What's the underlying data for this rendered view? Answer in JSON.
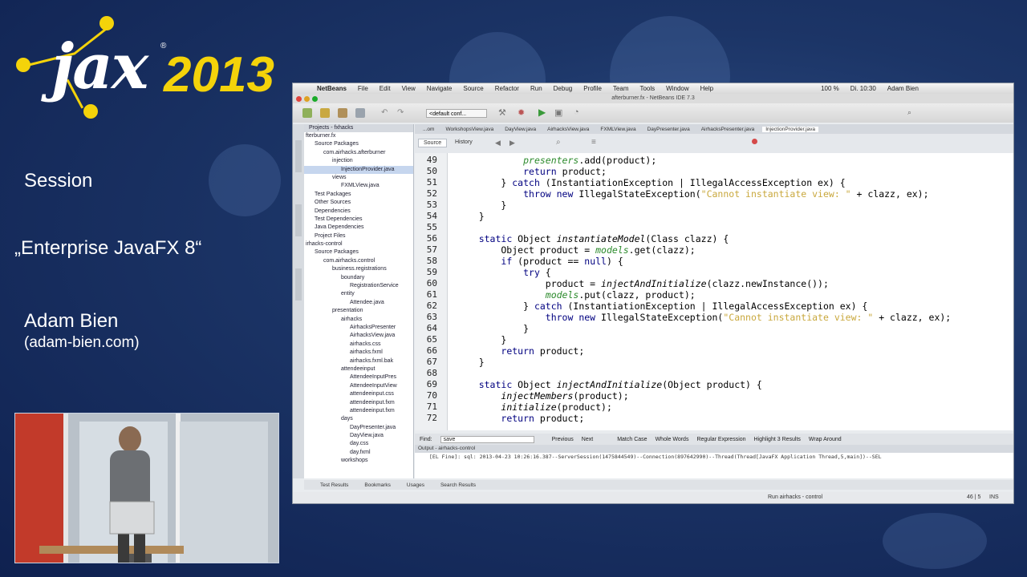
{
  "logo": {
    "word": "jax",
    "year": "2013",
    "reg": "®"
  },
  "sidebar": {
    "label_session": "Session",
    "talk_title": "„Enterprise JavaFX 8“",
    "speaker_name": "Adam Bien",
    "speaker_site": "(adam-bien.com)"
  },
  "ide": {
    "menu": [
      "NetBeans",
      "File",
      "Edit",
      "View",
      "Navigate",
      "Source",
      "Refactor",
      "Run",
      "Debug",
      "Profile",
      "Team",
      "Tools",
      "Window",
      "Help"
    ],
    "clock": "Di. 10:30",
    "battery": "100 %",
    "user": "Adam Bien",
    "window_title": "afterburner.fx - NetBeans IDE 7.3",
    "config_select": "<default conf...",
    "projects_tab": "Projects - fxhacks",
    "tree": [
      "fterburner.fx",
      "Source Packages",
      "com.airhacks.afterburner",
      "injection",
      "InjectionProvider.java",
      "views",
      "FXMLView.java",
      "Test Packages",
      "Other Sources",
      "Dependencies",
      "Test Dependencies",
      "Java Dependencies",
      "Project Files",
      "irhacks-control",
      "Source Packages",
      "com.airhacks.control",
      "business.registrations",
      "boundary",
      "RegistrationService",
      "entity",
      "Attendee.java",
      "presentation",
      "airhacks",
      "AirhacksPresenter",
      "AirhacksView.java",
      "airhacks.css",
      "airhacks.fxml",
      "airhacks.fxml.bak",
      "attendeeinput",
      "AttendeeInputPres",
      "AttendeeInputView",
      "attendeeinput.css",
      "attendeeinput.fxm",
      "attendeeinput.fxm",
      "days",
      "DayPresenter.java",
      "DayView.java",
      "day.css",
      "day.fxml",
      "workshops"
    ],
    "editor_tabs": [
      "...om",
      "WorkshopsView.java",
      "DayView.java",
      "AirhacksView.java",
      "FXMLView.java",
      "DayPresenter.java",
      "AirhacksPresenter.java",
      "InjectionProvider.java"
    ],
    "source_tab": "Source",
    "history_tab": "History",
    "code_lines": [
      {
        "n": "49",
        "segments": [
          {
            "t": "            "
          },
          {
            "t": "presenters",
            "c": "gr"
          },
          {
            "t": ".add(product);"
          }
        ]
      },
      {
        "n": "50",
        "segments": [
          {
            "t": "            "
          },
          {
            "t": "return",
            "c": "kw"
          },
          {
            "t": " product;"
          }
        ]
      },
      {
        "n": "51",
        "segments": [
          {
            "t": "        } "
          },
          {
            "t": "catch",
            "c": "kw"
          },
          {
            "t": " (InstantiationException | IllegalAccessException ex) {"
          }
        ]
      },
      {
        "n": "52",
        "segments": [
          {
            "t": "            "
          },
          {
            "t": "throw new",
            "c": "kw"
          },
          {
            "t": " IllegalStateException("
          },
          {
            "t": "\"Cannot instantiate view: \"",
            "c": "str"
          },
          {
            "t": " + clazz, ex);"
          }
        ]
      },
      {
        "n": "53",
        "segments": [
          {
            "t": "        }"
          }
        ]
      },
      {
        "n": "54",
        "segments": [
          {
            "t": "    }"
          }
        ]
      },
      {
        "n": "55",
        "segments": [
          {
            "t": ""
          }
        ]
      },
      {
        "n": "56",
        "segments": [
          {
            "t": "    "
          },
          {
            "t": "static",
            "c": "kw"
          },
          {
            "t": " Object "
          },
          {
            "t": "instantiateModel",
            "c": "it"
          },
          {
            "t": "(Class clazz) {"
          }
        ]
      },
      {
        "n": "57",
        "segments": [
          {
            "t": "        Object product = "
          },
          {
            "t": "models",
            "c": "gr"
          },
          {
            "t": ".get(clazz);"
          }
        ]
      },
      {
        "n": "58",
        "segments": [
          {
            "t": "        "
          },
          {
            "t": "if",
            "c": "kw"
          },
          {
            "t": " (product == "
          },
          {
            "t": "null",
            "c": "kw"
          },
          {
            "t": ") {"
          }
        ]
      },
      {
        "n": "59",
        "segments": [
          {
            "t": "            "
          },
          {
            "t": "try",
            "c": "kw"
          },
          {
            "t": " {"
          }
        ]
      },
      {
        "n": "60",
        "segments": [
          {
            "t": "                product = "
          },
          {
            "t": "injectAndInitialize",
            "c": "it"
          },
          {
            "t": "(clazz.newInstance());"
          }
        ]
      },
      {
        "n": "61",
        "segments": [
          {
            "t": "                "
          },
          {
            "t": "models",
            "c": "gr"
          },
          {
            "t": ".put(clazz, product);"
          }
        ]
      },
      {
        "n": "62",
        "segments": [
          {
            "t": "            } "
          },
          {
            "t": "catch",
            "c": "kw"
          },
          {
            "t": " (InstantiationException | IllegalAccessException ex) {"
          }
        ]
      },
      {
        "n": "63",
        "segments": [
          {
            "t": "                "
          },
          {
            "t": "throw new",
            "c": "kw"
          },
          {
            "t": " IllegalStateException("
          },
          {
            "t": "\"Cannot instantiate view: \"",
            "c": "str"
          },
          {
            "t": " + clazz, ex);"
          }
        ]
      },
      {
        "n": "64",
        "segments": [
          {
            "t": "            }"
          }
        ]
      },
      {
        "n": "65",
        "segments": [
          {
            "t": "        }"
          }
        ]
      },
      {
        "n": "66",
        "segments": [
          {
            "t": "        "
          },
          {
            "t": "return",
            "c": "kw"
          },
          {
            "t": " product;"
          }
        ]
      },
      {
        "n": "67",
        "segments": [
          {
            "t": "    }"
          }
        ]
      },
      {
        "n": "68",
        "segments": [
          {
            "t": ""
          }
        ]
      },
      {
        "n": "69",
        "segments": [
          {
            "t": "    "
          },
          {
            "t": "static",
            "c": "kw"
          },
          {
            "t": " Object "
          },
          {
            "t": "injectAndInitialize",
            "c": "it"
          },
          {
            "t": "(Object product) {"
          }
        ]
      },
      {
        "n": "70",
        "segments": [
          {
            "t": "        "
          },
          {
            "t": "injectMembers",
            "c": "it"
          },
          {
            "t": "(product);"
          }
        ]
      },
      {
        "n": "71",
        "segments": [
          {
            "t": "        "
          },
          {
            "t": "initialize",
            "c": "it"
          },
          {
            "t": "(product);"
          }
        ]
      },
      {
        "n": "72",
        "segments": [
          {
            "t": "        "
          },
          {
            "t": "return",
            "c": "kw"
          },
          {
            "t": " product;"
          }
        ]
      }
    ],
    "find": {
      "label": "Find:",
      "value": "save",
      "previous": "Previous",
      "next": "Next",
      "match_case": "Match Case",
      "whole_words": "Whole Words",
      "regex": "Regular Expression",
      "highlight": "Highlight 3 Results",
      "wrap": "Wrap Around"
    },
    "output_tab": "Output - airhacks-control",
    "output_line": "[EL Fine]: sql: 2013-04-23 10:26:16.387--ServerSession(1475844549)--Connection(897642990)--Thread(Thread[JavaFX Application Thread,5,main])--SEL",
    "bottom_tabs": [
      "Test Results",
      "Bookmarks",
      "Usages",
      "Search Results"
    ],
    "status_run": "Run airhacks - control",
    "status_pos": "46 | 5",
    "status_mode": "INS"
  },
  "colors": {
    "background": "#1c3567",
    "accent_yellow": "#f4d30a",
    "keyword": "#000080",
    "field": "#2b8a2b",
    "string": "#c9a83d"
  }
}
